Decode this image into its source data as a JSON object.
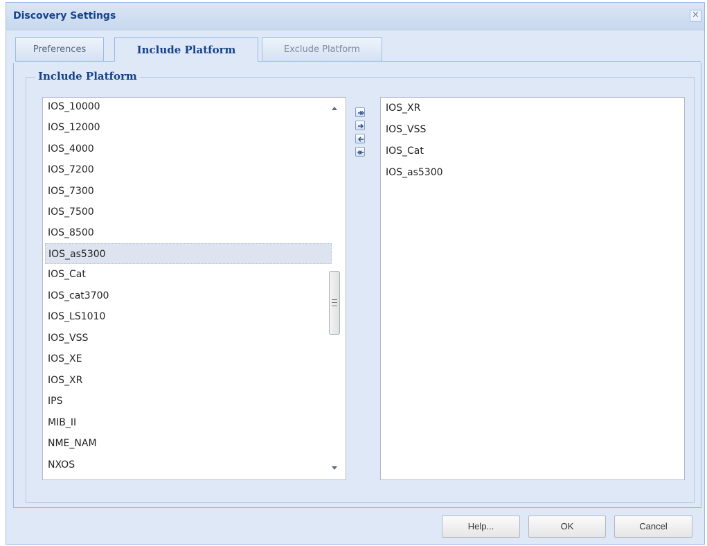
{
  "dialog": {
    "title": "Discovery Settings",
    "close_glyph": "×"
  },
  "tabs": [
    {
      "label": "Preferences"
    },
    {
      "label": "Include Platform"
    },
    {
      "label": "Exclude Platform"
    }
  ],
  "fieldset": {
    "legend": "Include Platform"
  },
  "available_list": {
    "items": [
      "IOS_10000",
      "IOS_12000",
      "IOS_4000",
      "IOS_7200",
      "IOS_7300",
      "IOS_7500",
      "IOS_8500",
      "IOS_as5300",
      "IOS_Cat",
      "IOS_cat3700",
      "IOS_LS1010",
      "IOS_VSS",
      "IOS_XE",
      "IOS_XR",
      "IPS",
      "MIB_II",
      "NME_NAM",
      "NXOS"
    ],
    "selected_item": "IOS_as5300"
  },
  "selected_list": {
    "items": [
      "IOS_XR",
      "IOS_VSS",
      "IOS_Cat",
      "IOS_as5300"
    ]
  },
  "transfer_buttons": [
    "add-all-icon",
    "add-icon",
    "remove-icon",
    "remove-all-icon"
  ],
  "footer": {
    "help": "Help...",
    "ok": "OK",
    "cancel": "Cancel"
  }
}
